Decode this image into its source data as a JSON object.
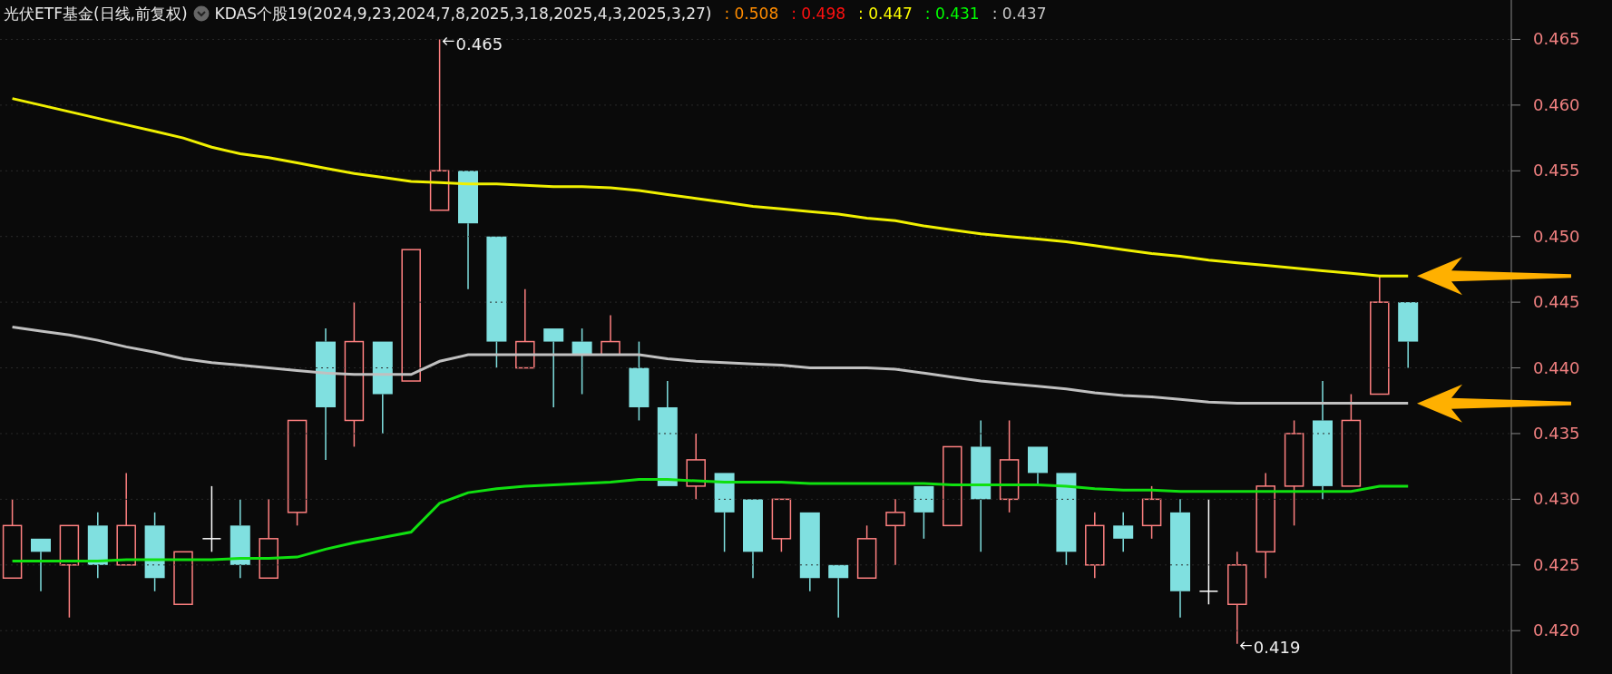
{
  "header": {
    "title": "光伏ETF基金(日线,前复权)",
    "indicator_name": "KDAS个股19(2024,9,23,2024,7,8,2025,3,18,2025,4,3,2025,3,27)",
    "values": [
      {
        "text": ": 0.508",
        "color": "#ff8c00"
      },
      {
        "text": ": 0.498",
        "color": "#ff1010"
      },
      {
        "text": ": 0.447",
        "color": "#ffff00"
      },
      {
        "text": ": 0.431",
        "color": "#00ff00"
      },
      {
        "text": ": 0.437",
        "color": "#c8c8c8"
      }
    ]
  },
  "chart_data": {
    "type": "line",
    "ylim": [
      0.4167,
      0.468
    ],
    "grid": true,
    "yticks": [
      {
        "value": 0.465,
        "label": "0.465"
      },
      {
        "value": 0.46,
        "label": "0.460"
      },
      {
        "value": 0.455,
        "label": "0.455"
      },
      {
        "value": 0.45,
        "label": "0.450"
      },
      {
        "value": 0.445,
        "label": "0.445"
      },
      {
        "value": 0.44,
        "label": "0.440"
      },
      {
        "value": 0.435,
        "label": "0.435"
      },
      {
        "value": 0.43,
        "label": "0.430"
      },
      {
        "value": 0.425,
        "label": "0.425"
      },
      {
        "value": 0.42,
        "label": "0.420"
      }
    ],
    "series": [
      {
        "color": "#f0f000",
        "values": [
          0.4605,
          0.46,
          0.4595,
          0.459,
          0.4585,
          0.458,
          0.4575,
          0.4568,
          0.4563,
          0.456,
          0.4556,
          0.4552,
          0.4548,
          0.4545,
          0.4542,
          0.4541,
          0.454,
          0.454,
          0.4539,
          0.4538,
          0.4538,
          0.4537,
          0.4535,
          0.4532,
          0.4529,
          0.4526,
          0.4523,
          0.4521,
          0.4519,
          0.4517,
          0.4514,
          0.4512,
          0.4508,
          0.4505,
          0.4502,
          0.45,
          0.4498,
          0.4496,
          0.4493,
          0.449,
          0.4487,
          0.4485,
          0.4482,
          0.448,
          0.4478,
          0.4476,
          0.4474,
          0.4472,
          0.447,
          0.447
        ]
      },
      {
        "color": "#c0c0c0",
        "values": [
          0.4431,
          0.4428,
          0.4425,
          0.4421,
          0.4416,
          0.4412,
          0.4407,
          0.4404,
          0.4402,
          0.44,
          0.4398,
          0.4396,
          0.4395,
          0.4395,
          0.4395,
          0.4405,
          0.441,
          0.441,
          0.441,
          0.441,
          0.441,
          0.441,
          0.441,
          0.4407,
          0.4405,
          0.4404,
          0.4403,
          0.4402,
          0.44,
          0.44,
          0.44,
          0.4399,
          0.4396,
          0.4393,
          0.439,
          0.4388,
          0.4386,
          0.4384,
          0.4381,
          0.4379,
          0.4378,
          0.4376,
          0.4374,
          0.4373,
          0.4373,
          0.4373,
          0.4373,
          0.4373,
          0.4373,
          0.4373
        ]
      },
      {
        "color": "#10e010",
        "values": [
          0.4253,
          0.4253,
          0.4253,
          0.4253,
          0.4254,
          0.4254,
          0.4254,
          0.4254,
          0.4255,
          0.4255,
          0.4256,
          0.4262,
          0.4267,
          0.4271,
          0.4275,
          0.4297,
          0.4305,
          0.4308,
          0.431,
          0.4311,
          0.4312,
          0.4313,
          0.4315,
          0.4315,
          0.4314,
          0.4313,
          0.4313,
          0.4313,
          0.4312,
          0.4312,
          0.4312,
          0.4312,
          0.4312,
          0.4311,
          0.4311,
          0.4311,
          0.4311,
          0.431,
          0.4308,
          0.4307,
          0.4307,
          0.4306,
          0.4306,
          0.4306,
          0.4306,
          0.4306,
          0.4306,
          0.4306,
          0.431,
          0.431
        ]
      }
    ],
    "annotations": [
      "0.465",
      "0.419"
    ]
  },
  "pointer_arrows": [
    {
      "color": "#ffb000"
    },
    {
      "color": "#ffb000"
    }
  ]
}
